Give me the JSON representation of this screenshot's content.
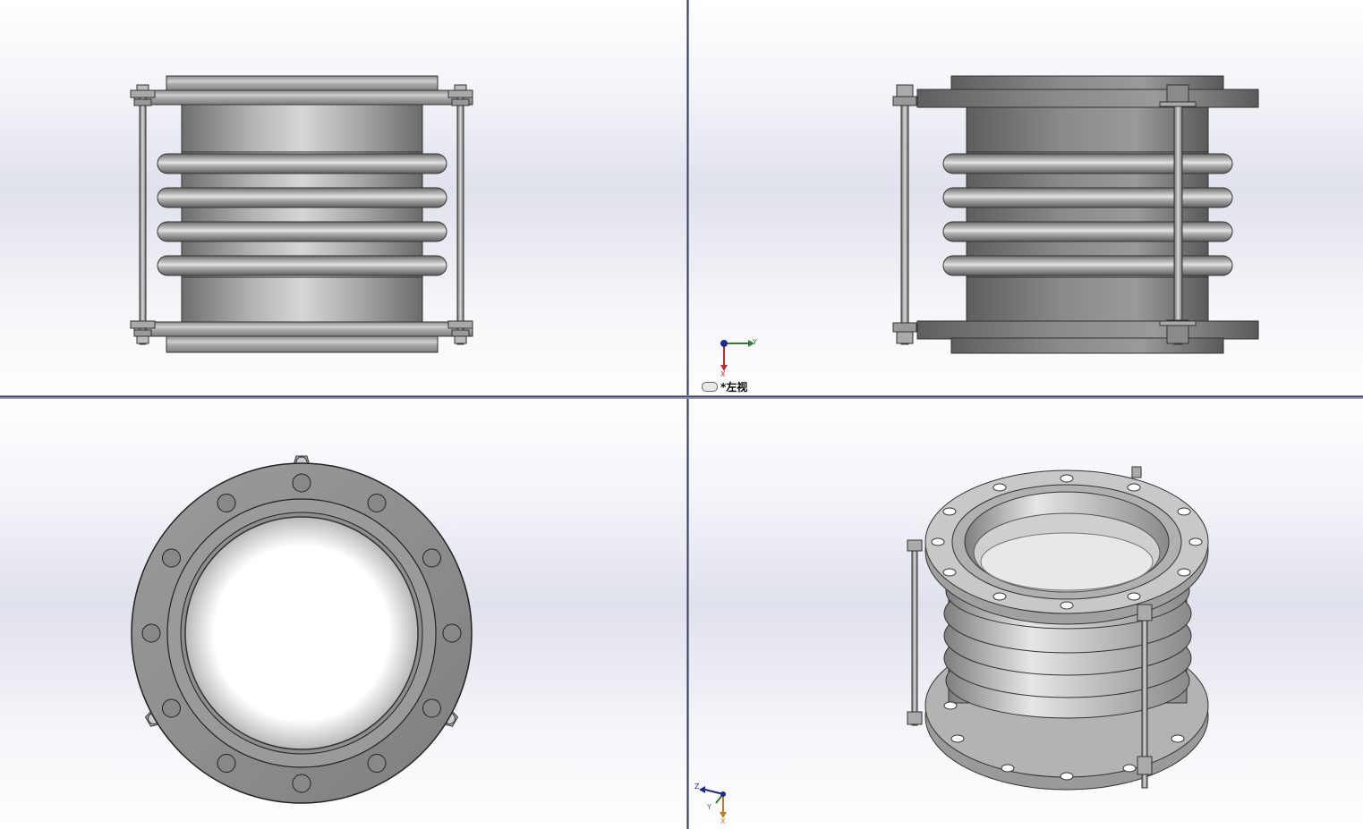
{
  "active_view": {
    "label": "*左视"
  },
  "triad_left": {
    "y": "Y",
    "x": "X"
  },
  "triad_iso": {
    "z": "Z",
    "y": "Y",
    "x": "X"
  },
  "colors": {
    "axis_x": "#c62828",
    "axis_y": "#2e7d32",
    "axis_z": "#1a2a8f",
    "metal_dark": "#7a7a7a",
    "metal_light": "#d8d8d8",
    "background": "#e0e2ee"
  },
  "views": [
    "front-view",
    "left-view",
    "top-view",
    "isometric-view"
  ]
}
